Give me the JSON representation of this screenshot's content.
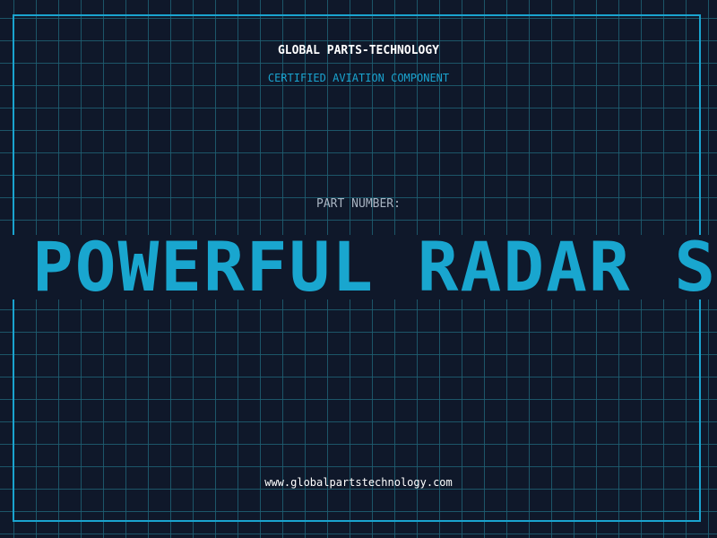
{
  "header": {
    "company": "GLOBAL PARTS-TECHNOLOGY",
    "tagline": "CERTIFIED AVIATION COMPONENT"
  },
  "part": {
    "label": "PART NUMBER:",
    "value": "POWERFUL RADAR SY"
  },
  "footer": {
    "website": "www.globalpartstechnology.com"
  },
  "colors": {
    "background": "#0f182a",
    "accent": "#1aa3cf",
    "grid": "#1f5f73",
    "label": "#a9b4c2"
  }
}
